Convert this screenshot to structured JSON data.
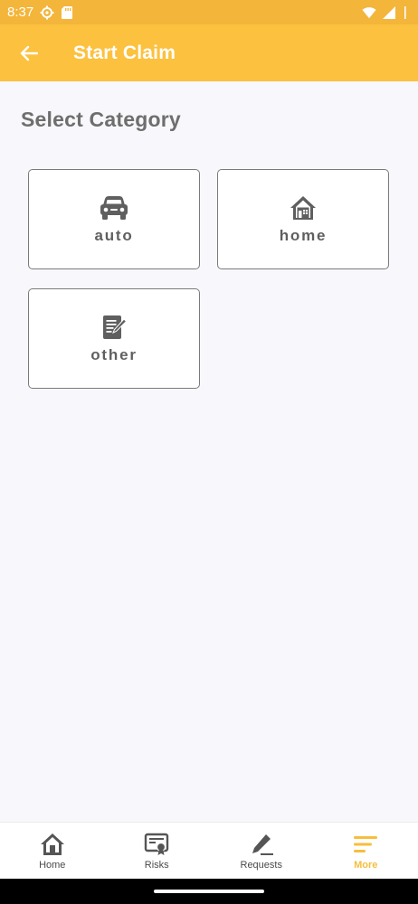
{
  "status_bar": {
    "time": "8:37",
    "icons": [
      "settings-icon",
      "sd-card-icon",
      "wifi-icon",
      "signal-icon",
      "battery-icon"
    ]
  },
  "app_bar": {
    "title": "Start Claim",
    "back_icon": "arrow-left-icon"
  },
  "main": {
    "section_title": "Select Category",
    "categories": [
      {
        "label": "auto",
        "icon": "car-icon"
      },
      {
        "label": "home",
        "icon": "house-icon"
      },
      {
        "label": "other",
        "icon": "document-edit-icon"
      }
    ]
  },
  "bottom_nav": {
    "items": [
      {
        "label": "Home",
        "icon": "home-icon",
        "active": false
      },
      {
        "label": "Risks",
        "icon": "certificate-icon",
        "active": false
      },
      {
        "label": "Requests",
        "icon": "pencil-icon",
        "active": false
      },
      {
        "label": "More",
        "icon": "menu-lines-icon",
        "active": true
      }
    ]
  },
  "colors": {
    "status_bar": "#f3b53a",
    "app_bar": "#fcc13f",
    "accent": "#f7be3b",
    "background": "#f8f7fb",
    "card_border": "#7a7a7a",
    "icon_gray": "#5f5f5f"
  }
}
